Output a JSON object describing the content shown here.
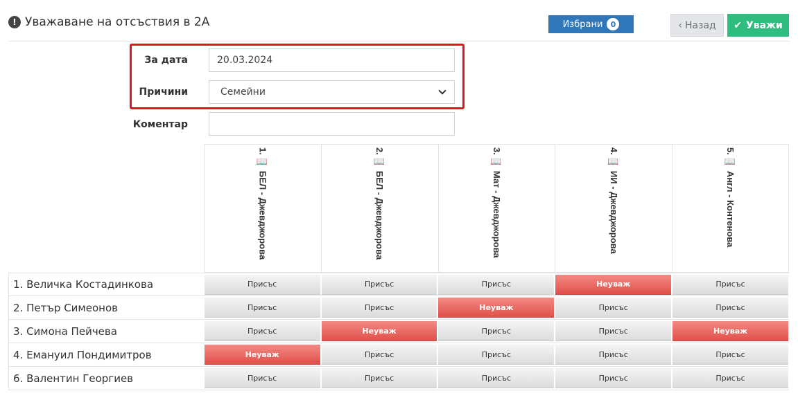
{
  "header": {
    "title": "Уважаване на отсъствия в 2А",
    "selected_label": "Избрани",
    "selected_count": "0",
    "back_label": "Назад",
    "excuse_label": "Уважи"
  },
  "form": {
    "date_label": "За дата",
    "date_value": "20.03.2024",
    "reasons_label": "Причини",
    "reasons_value": "Семейни",
    "comment_label": "Коментар",
    "comment_value": ""
  },
  "grid": {
    "columns": [
      "1. 📖 БЕЛ - Джевджорова",
      "2. 📖 БЕЛ - Джевджорова",
      "3. 📖 Мат - Джевджорова",
      "4. 📖 ИИ - Джевджорова",
      "5. 📖 Англ - Контенова"
    ],
    "rows": [
      {
        "name": "1. Величка Костадинкова",
        "cells": [
          "Присъс",
          "Присъс",
          "Присъс",
          "Неуваж",
          "Присъс"
        ]
      },
      {
        "name": "2. Петър Симеонов",
        "cells": [
          "Присъс",
          "Присъс",
          "Неуваж",
          "Присъс",
          "Присъс"
        ]
      },
      {
        "name": "3. Симона Пейчева",
        "cells": [
          "Присъс",
          "Неуваж",
          "Присъс",
          "Присъс",
          "Неуваж"
        ]
      },
      {
        "name": "4. Емануил Пондимитров",
        "cells": [
          "Неуваж",
          "Присъс",
          "Присъс",
          "Присъс",
          "Присъс"
        ]
      },
      {
        "name": "6. Валентин Георгиев",
        "cells": [
          "Присъс",
          "Присъс",
          "Присъс",
          "Присъс",
          "Присъс"
        ]
      }
    ]
  },
  "colors": {
    "primary": "#2f77b9",
    "success": "#2ebd7e",
    "unexcused": "#e0504a",
    "highlight": "#e3141b"
  }
}
